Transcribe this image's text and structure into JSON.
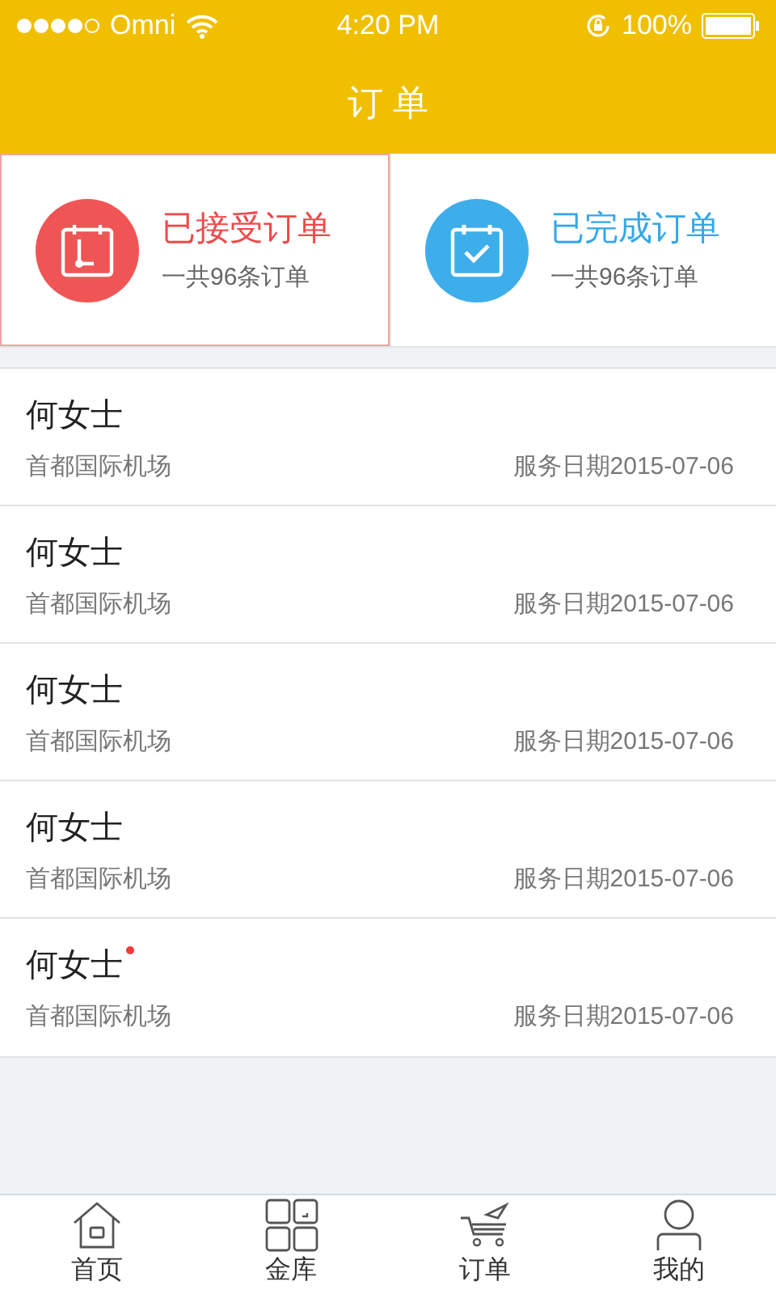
{
  "status_bar": {
    "carrier": "Omni",
    "time": "4:20 PM",
    "battery": "100%"
  },
  "header": {
    "title": "订 单"
  },
  "summary_cards": [
    {
      "kind": "accepted",
      "title": "已接受订单",
      "count": "一共96条订单",
      "selected": true
    },
    {
      "kind": "completed",
      "title": "已完成订单",
      "count": "一共96条订单",
      "selected": false
    }
  ],
  "orders": [
    {
      "name": "何女士",
      "place": "首都国际机场",
      "date": "服务日期2015-07-06",
      "unread": false
    },
    {
      "name": "何女士",
      "place": "首都国际机场",
      "date": "服务日期2015-07-06",
      "unread": false
    },
    {
      "name": "何女士",
      "place": "首都国际机场",
      "date": "服务日期2015-07-06",
      "unread": false
    },
    {
      "name": "何女士",
      "place": "首都国际机场",
      "date": "服务日期2015-07-06",
      "unread": false
    },
    {
      "name": "何女士",
      "place": "首都国际机场",
      "date": "服务日期2015-07-06",
      "unread": true
    }
  ],
  "tab_bar": [
    {
      "kind": "home",
      "label": "首页"
    },
    {
      "kind": "vault",
      "label": "金库"
    },
    {
      "kind": "orders",
      "label": "订单"
    },
    {
      "kind": "me",
      "label": "我的"
    }
  ]
}
